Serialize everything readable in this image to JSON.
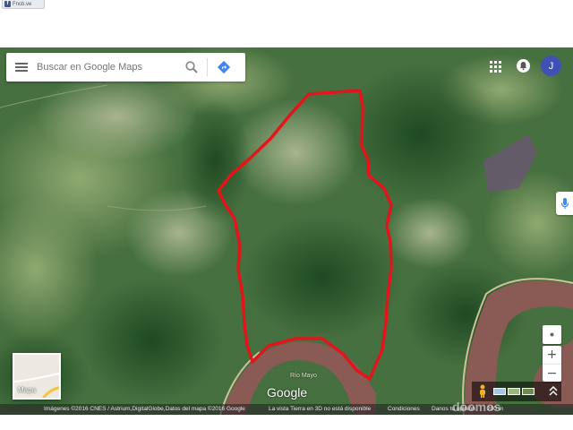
{
  "browser": {
    "tab_title": "Fncb.ve",
    "tab_icon": "facebook-icon"
  },
  "search": {
    "placeholder": "Buscar en Google Maps",
    "menu_icon": "hamburger-menu-icon",
    "search_icon": "search-icon",
    "directions_icon": "directions-icon"
  },
  "header": {
    "apps_icon": "apps-grid-icon",
    "notifications_icon": "notifications-icon",
    "avatar_initial": "J"
  },
  "map": {
    "river_label": "Río Mayo",
    "logo": "Google",
    "minimap_label": "Mapa",
    "boundary_color": "#e4141b",
    "river_color": "#8a5a55"
  },
  "controls": {
    "my_location_icon": "my-location-icon",
    "zoom_in": "+",
    "zoom_out": "−",
    "pegman_icon": "pegman-icon",
    "expand_icon": "chevron-up-icon"
  },
  "footer": {
    "imagery": "Imágenes ©2016 CNES / Astrium,DigitalGlobe,Datos del mapa ©2016 Google",
    "earth_notice": "La vista Tierra en 3D no está disponible",
    "terms": "Condiciones",
    "feedback": "Danos tu opinión",
    "scale": "200 m"
  },
  "watermark": "doomos"
}
